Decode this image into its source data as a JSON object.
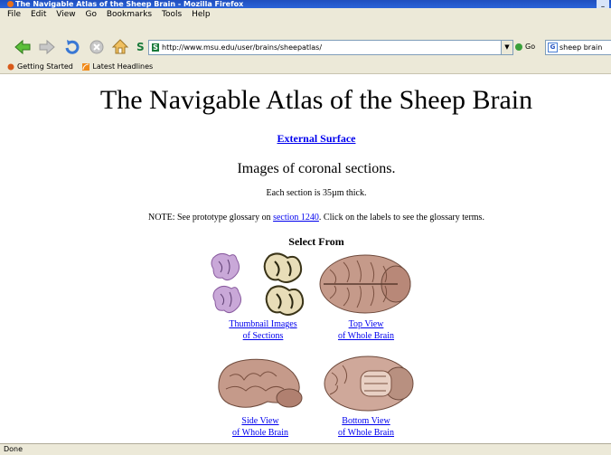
{
  "window": {
    "title": "The Navigable Atlas of the Sheep Brain - Mozilla Firefox"
  },
  "menu": {
    "items": [
      "File",
      "Edit",
      "View",
      "Go",
      "Bookmarks",
      "Tools",
      "Help"
    ]
  },
  "toolbar": {
    "url": "http://www.msu.edu/user/brains/sheepatlas/",
    "go_label": "Go",
    "search_value": "sheep brain"
  },
  "bookmarks": {
    "items": [
      "Getting Started",
      "Latest Headlines"
    ]
  },
  "page": {
    "title": "The Navigable Atlas of the Sheep Brain",
    "external_link": "External Surface",
    "subtitle": "Images of coronal sections.",
    "thickness": "Each section is 35µm thick.",
    "note_before": "NOTE: See prototype glossary on ",
    "note_link": "section 1240",
    "note_after": ". Click on the labels to see the glossary terms.",
    "select_heading": "Select From",
    "links": [
      {
        "line1": "Thumbnail Images",
        "line2": "of Sections"
      },
      {
        "line1": "Top View",
        "line2": "of Whole Brain"
      },
      {
        "line1": "Side View",
        "line2": "of Whole Brain"
      },
      {
        "line1": "Bottom View",
        "line2": "of Whole Brain"
      }
    ]
  },
  "status": {
    "text": "Done"
  }
}
